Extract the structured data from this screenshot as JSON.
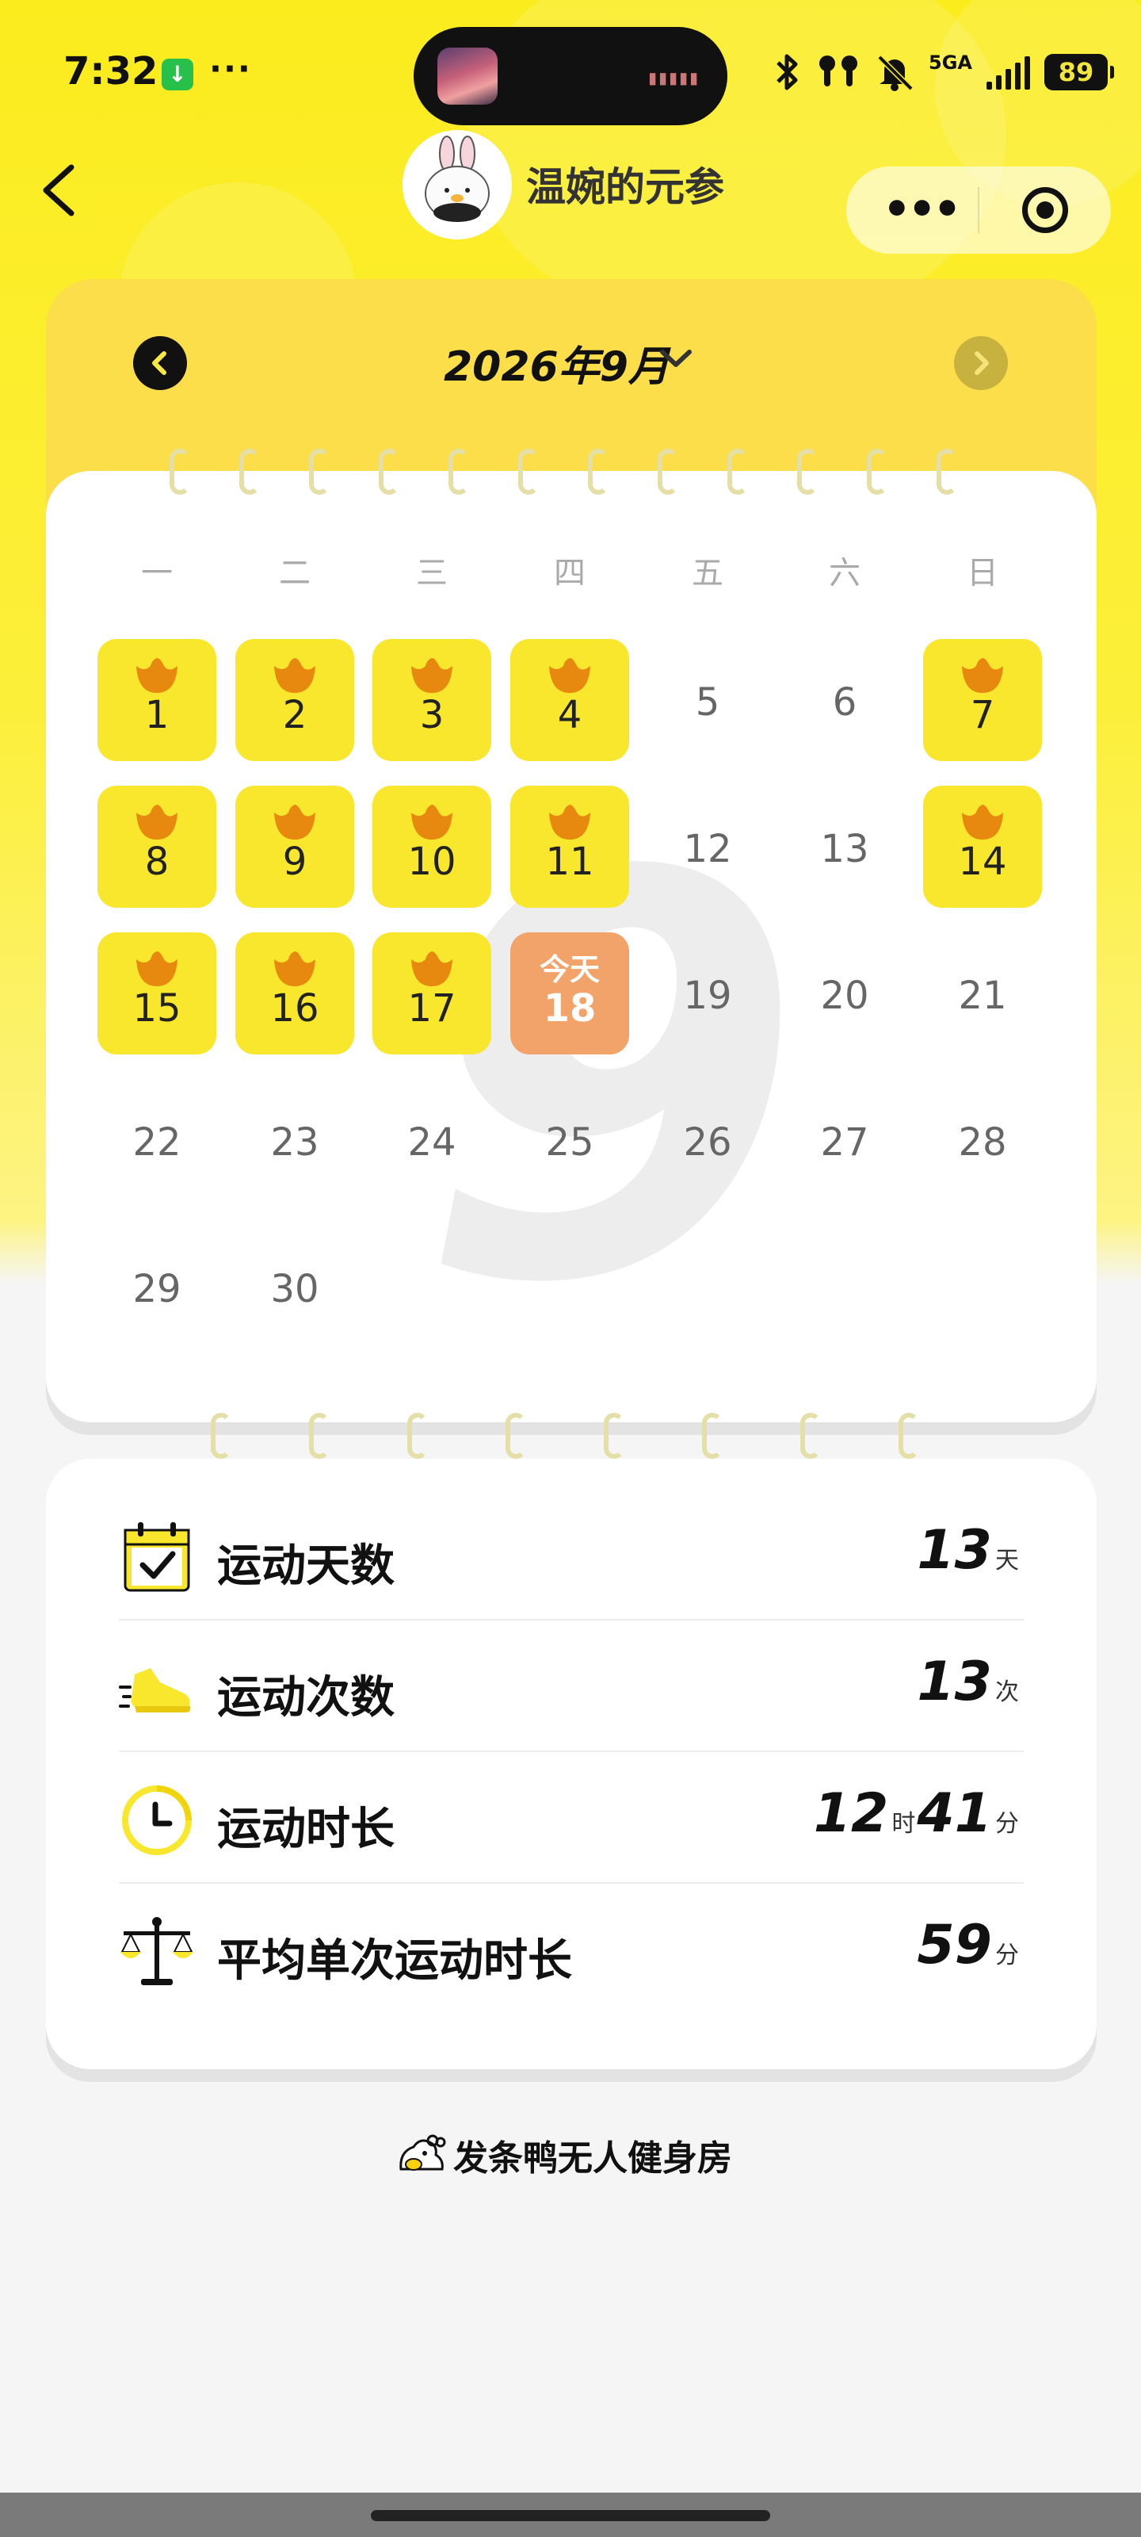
{
  "status_bar": {
    "time": "7:32",
    "more": "···",
    "network": "5GA",
    "battery": "89"
  },
  "nav": {
    "title": "温婉的元参"
  },
  "calendar": {
    "month_title": "2026年9月",
    "watermark": "9",
    "weekdays": [
      "一",
      "二",
      "三",
      "四",
      "五",
      "六",
      "日"
    ],
    "today_label": "今天",
    "today": 18,
    "checked_days": [
      1,
      2,
      3,
      4,
      7,
      8,
      9,
      10,
      11,
      14,
      15,
      16,
      17
    ],
    "days_in_month": 30,
    "first_weekday_index": 1
  },
  "stats": {
    "rows": [
      {
        "label": "运动天数",
        "value": "13",
        "unit": "天",
        "icon": "calendar-check-icon"
      },
      {
        "label": "运动次数",
        "value": "13",
        "unit": "次",
        "icon": "sneaker-icon"
      },
      {
        "label": "运动时长",
        "hours": "12",
        "hours_unit": "时",
        "minutes": "41",
        "minutes_unit": "分",
        "icon": "clock-icon"
      },
      {
        "label": "平均单次运动时长",
        "value": "59",
        "unit": "分",
        "icon": "balance-scale-icon"
      }
    ]
  },
  "footer": {
    "brand": "发条鸭无人健身房"
  },
  "colors": {
    "accent_yellow": "#f8e72c",
    "today_orange": "#f2a36a",
    "duck_orange": "#e8890f"
  }
}
